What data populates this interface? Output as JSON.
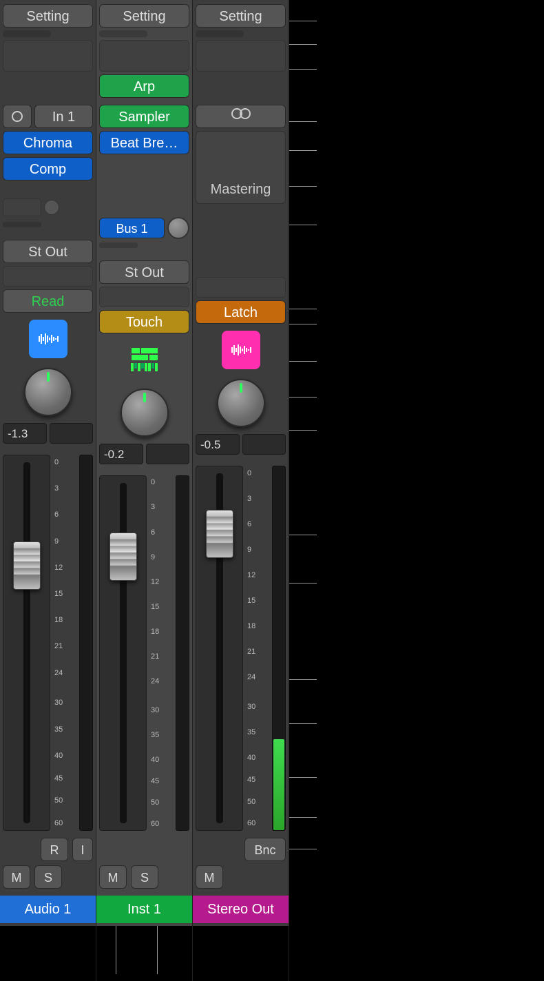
{
  "strips": [
    {
      "setting_label": "Setting",
      "gain": {},
      "input_circle": true,
      "input_label": "In 1",
      "midi_fx": [],
      "instrument": null,
      "audio_fx": [
        "Chroma",
        "Comp"
      ],
      "sends": [],
      "output_label": "St Out",
      "automation": {
        "label": "Read",
        "class": "auto-read",
        "btn_class": ""
      },
      "icon": "wave-blue",
      "db_value": "-1.3",
      "fader_pos_pct": 23,
      "scale": [
        "0",
        "3",
        "6",
        "9",
        "12",
        "15",
        "18",
        "21",
        "24",
        "30",
        "35",
        "40",
        "45",
        "50",
        "60"
      ],
      "ri": {
        "r": "R",
        "i": "I"
      },
      "mute": "M",
      "solo": "S",
      "name": "Audio 1",
      "name_class": "name-blue"
    },
    {
      "setting_label": "Setting",
      "gain": {},
      "midi_fx": [
        "Arp"
      ],
      "instrument": "Sampler",
      "audio_fx": [
        "Beat Bre…"
      ],
      "sends": [
        {
          "label": "Bus 1"
        }
      ],
      "output_label": "St Out",
      "automation": {
        "label": "Touch",
        "class": "",
        "btn_class": "mustard"
      },
      "icon": "freeze-green",
      "db_value": "-0.2",
      "fader_pos_pct": 16,
      "scale": [
        "0",
        "3",
        "6",
        "9",
        "12",
        "15",
        "18",
        "21",
        "24",
        "30",
        "35",
        "40",
        "45",
        "50",
        "60"
      ],
      "mute": "M",
      "solo": "S",
      "name": "Inst 1",
      "name_class": "name-green"
    },
    {
      "setting_label": "Setting",
      "gain": {},
      "midi_fx": [],
      "instrument_stereo_icon": true,
      "mastering_label": "Mastering",
      "sends": [],
      "automation": {
        "label": "Latch",
        "class": "",
        "btn_class": "orange"
      },
      "icon": "wave-magenta",
      "db_value": "-0.5",
      "fader_pos_pct": 12,
      "scale": [
        "0",
        "3",
        "6",
        "9",
        "12",
        "15",
        "18",
        "21",
        "24",
        "30",
        "35",
        "40",
        "45",
        "50",
        "60"
      ],
      "bnc": "Bnc",
      "mute": "M",
      "name": "Stereo Out",
      "name_class": "name-magenta"
    }
  ]
}
